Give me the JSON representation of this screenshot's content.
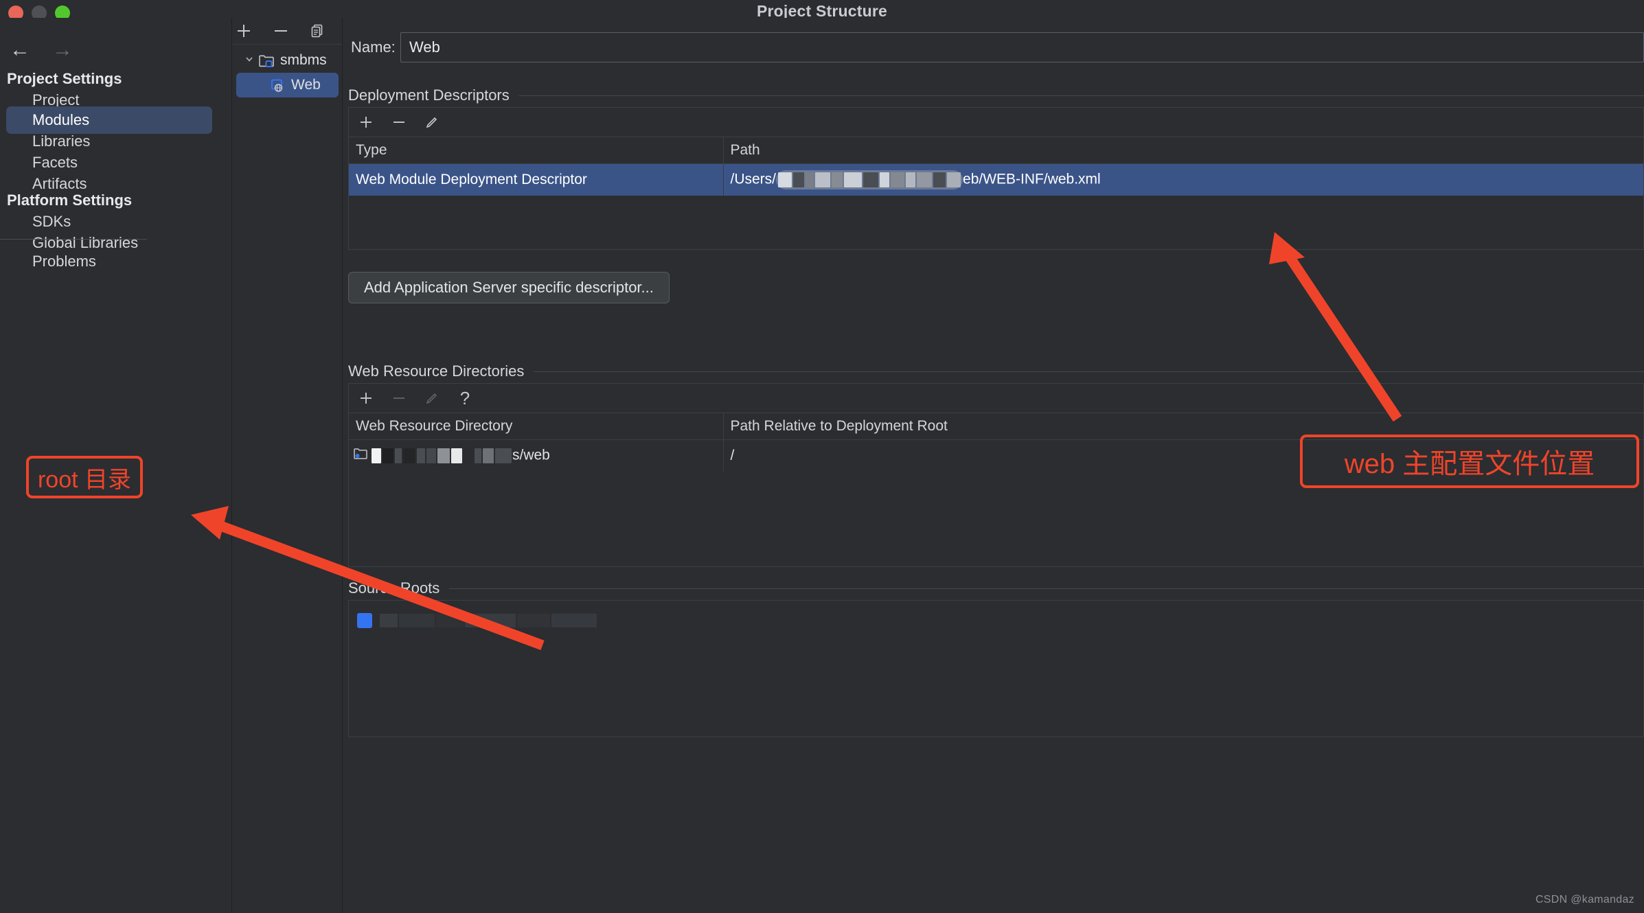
{
  "window": {
    "title": "Project Structure",
    "traffic_lights": [
      "close",
      "minimize",
      "zoom"
    ]
  },
  "sidebar": {
    "nav": {
      "back": "←",
      "forward": "→"
    },
    "groups": [
      {
        "title": "Project Settings",
        "items": [
          {
            "label": "Project",
            "selected": false
          },
          {
            "label": "Modules",
            "selected": true
          },
          {
            "label": "Libraries",
            "selected": false
          },
          {
            "label": "Facets",
            "selected": false
          },
          {
            "label": "Artifacts",
            "selected": false
          }
        ]
      },
      {
        "title": "Platform Settings",
        "items": [
          {
            "label": "SDKs",
            "selected": false
          },
          {
            "label": "Global Libraries",
            "selected": false
          }
        ]
      }
    ],
    "problems": {
      "label": "Problems"
    }
  },
  "module_panel": {
    "toolbar": [
      {
        "name": "add-module-button",
        "glyph": "+"
      },
      {
        "name": "remove-module-button",
        "glyph": "−"
      },
      {
        "name": "copy-module-button",
        "glyph": "⧉"
      }
    ],
    "tree": [
      {
        "label": "smbms",
        "icon": "module-folder-icon",
        "depth": 0,
        "expanded": true,
        "selected": false
      },
      {
        "label": "Web",
        "icon": "web-module-icon",
        "depth": 1,
        "expanded": false,
        "selected": true
      }
    ]
  },
  "main": {
    "name_field": {
      "label": "Name:",
      "value": "Web",
      "placeholder": ""
    },
    "deployment_descriptors": {
      "title": "Deployment Descriptors",
      "toolbar": [
        {
          "name": "add-descriptor-button",
          "glyph": "+",
          "enabled": true
        },
        {
          "name": "remove-descriptor-button",
          "glyph": "−",
          "enabled": true
        },
        {
          "name": "edit-descriptor-button",
          "glyph": "pencil",
          "enabled": true
        }
      ],
      "columns": [
        "Type",
        "Path"
      ],
      "rows": [
        {
          "type": "Web Module Deployment Descriptor",
          "path_prefix": "/Users/",
          "path_redacted": true,
          "path_suffix": "eb/WEB-INF/web.xml",
          "selected": true
        }
      ],
      "add_button_label": "Add Application Server specific descriptor..."
    },
    "web_resource_directories": {
      "title": "Web Resource Directories",
      "toolbar": [
        {
          "name": "add-web-resource-button",
          "glyph": "+",
          "enabled": true
        },
        {
          "name": "remove-web-resource-button",
          "glyph": "−",
          "enabled": false
        },
        {
          "name": "edit-web-resource-button",
          "glyph": "pencil",
          "enabled": false
        },
        {
          "name": "help-button",
          "glyph": "?",
          "enabled": true
        }
      ],
      "columns": [
        "Web Resource Directory",
        "Path Relative to Deployment Root"
      ],
      "rows": [
        {
          "directory_redacted": true,
          "directory_suffix": "s/web",
          "relative_path": "/",
          "selected": false
        }
      ]
    },
    "source_roots": {
      "title": "Source Roots"
    }
  },
  "annotations": [
    {
      "id": "root-dir-note",
      "text": "root 目录",
      "color": "#f0442a"
    },
    {
      "id": "web-config-note",
      "text": "web 主配置文件位置",
      "color": "#f0442a"
    }
  ],
  "watermark": {
    "text": "CSDN @kamandaz"
  },
  "colors": {
    "window_bg": "#2b2d30",
    "selection_blue": "#3b5488",
    "sidebar_selection": "#3b4a66",
    "annotation_red": "#f0442a",
    "accent_icon_blue": "#3574f0"
  }
}
